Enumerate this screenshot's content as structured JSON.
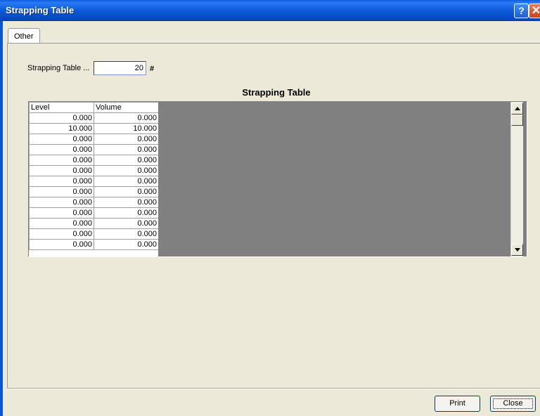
{
  "window": {
    "title": "Strapping Table",
    "help_glyph": "?",
    "close_glyph": "✕"
  },
  "tabs": [
    {
      "label": "Other"
    }
  ],
  "form": {
    "count_label": "Strapping Table ...",
    "count_value": "20",
    "count_unit": "#"
  },
  "table": {
    "title": "Strapping Table",
    "columns": [
      "Level",
      "Volume"
    ],
    "rows": [
      [
        "0.000",
        "0.000"
      ],
      [
        "10.000",
        "10.000"
      ],
      [
        "0.000",
        "0.000"
      ],
      [
        "0.000",
        "0.000"
      ],
      [
        "0.000",
        "0.000"
      ],
      [
        "0.000",
        "0.000"
      ],
      [
        "0.000",
        "0.000"
      ],
      [
        "0.000",
        "0.000"
      ],
      [
        "0.000",
        "0.000"
      ],
      [
        "0.000",
        "0.000"
      ],
      [
        "0.000",
        "0.000"
      ],
      [
        "0.000",
        "0.000"
      ],
      [
        "0.000",
        "0.000"
      ]
    ]
  },
  "buttons": {
    "print": "Print",
    "close": "Close"
  },
  "colors": {
    "titlebar": "#0a5ae0",
    "dialog_bg": "#ece9d8",
    "grid_empty": "#808080"
  }
}
